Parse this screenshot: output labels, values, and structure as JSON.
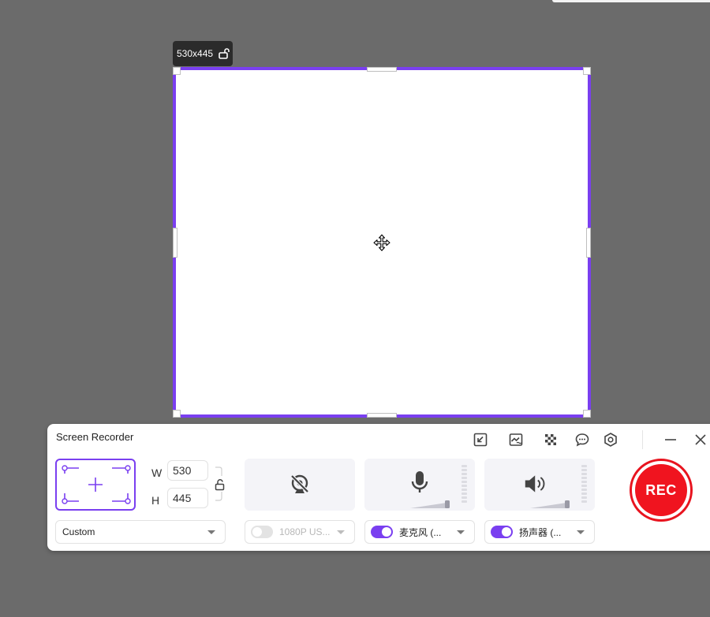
{
  "selection": {
    "size_label": "530x445",
    "lock_icon": "unlock-icon",
    "move_icon": "move-icon"
  },
  "recorder": {
    "title": "Screen Recorder",
    "toolbar": [
      "export-icon",
      "chart-wave-icon",
      "mosaic-icon",
      "chat-icon",
      "settings-icon",
      "minimize-icon",
      "close-icon"
    ],
    "width_label": "W",
    "height_label": "H",
    "width_value": "530",
    "height_value": "445",
    "mode_value": "Custom",
    "camera": {
      "icon": "camera-off-icon",
      "device": "1080P US...",
      "enabled": false
    },
    "microphone": {
      "icon": "microphone-icon",
      "device": "麦克风 (...",
      "enabled": true
    },
    "speaker": {
      "icon": "speaker-icon",
      "device": "扬声器 (...",
      "enabled": true
    },
    "rec_label": "REC"
  },
  "colors": {
    "accent": "#7a3ff0",
    "rec": "#f0141f",
    "backdrop": "#6b6b6b"
  }
}
